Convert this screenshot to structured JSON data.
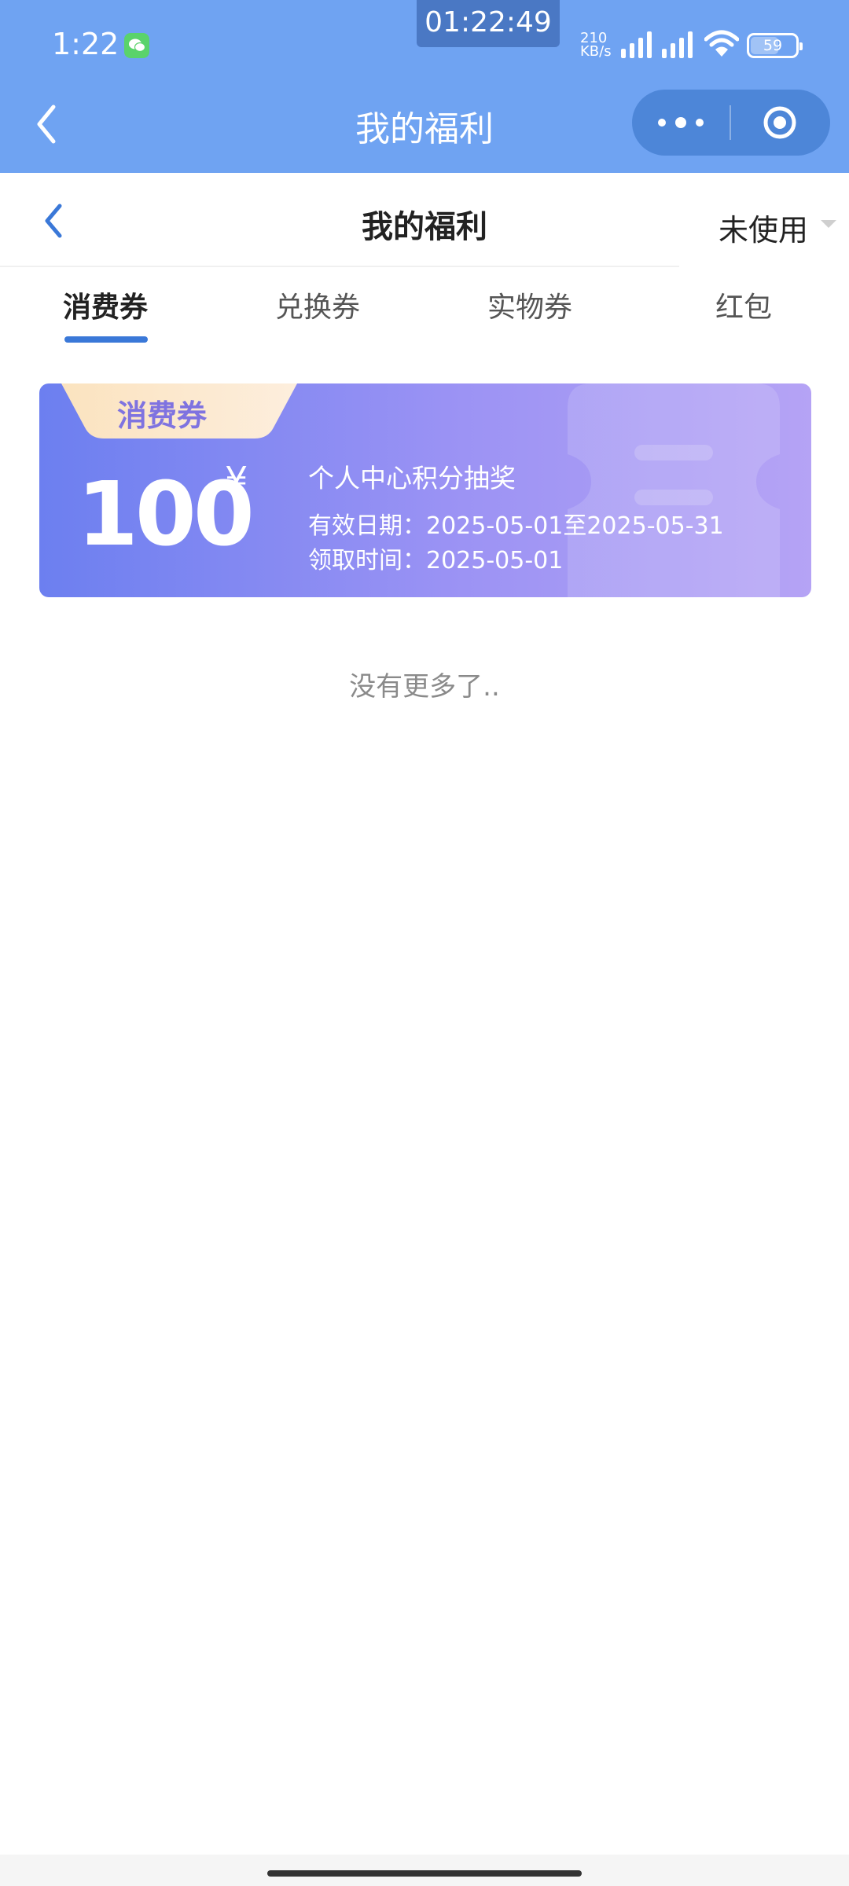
{
  "status_bar": {
    "time": "1:22",
    "clock_overlay": "01:22:49",
    "net_speed_value": "210",
    "net_speed_unit": "KB/s",
    "battery_level": "59",
    "icons": [
      "wechat-icon",
      "signal-icon",
      "signal-icon",
      "wifi-icon",
      "battery-icon"
    ]
  },
  "nav": {
    "title": "我的福利",
    "back_icon": "chevron-left-icon",
    "more_icon": "more-dots-icon",
    "close_icon": "target-circle-icon"
  },
  "page_header": {
    "title": "我的福利",
    "filter_label": "未使用"
  },
  "tabs": [
    {
      "label": "消费券",
      "active": true
    },
    {
      "label": "兑换券",
      "active": false
    },
    {
      "label": "实物券",
      "active": false
    },
    {
      "label": "红包",
      "active": false
    }
  ],
  "coupons": [
    {
      "tag": "消费券",
      "amount": "100",
      "currency": "¥",
      "name": "个人中心积分抽奖",
      "valid_period": "有效日期：2025-05-01至2025-05-31",
      "received_time": "领取时间：2025-05-01"
    }
  ],
  "list_end_text": "没有更多了..",
  "colors": {
    "nav_bg": "#6fa3f2",
    "capsule_bg": "#4d86d8",
    "tab_underline": "#3a78d8",
    "coupon_start": "#6c7ff0",
    "coupon_end": "#b5a3f5",
    "tag_text": "#7f73e0"
  }
}
